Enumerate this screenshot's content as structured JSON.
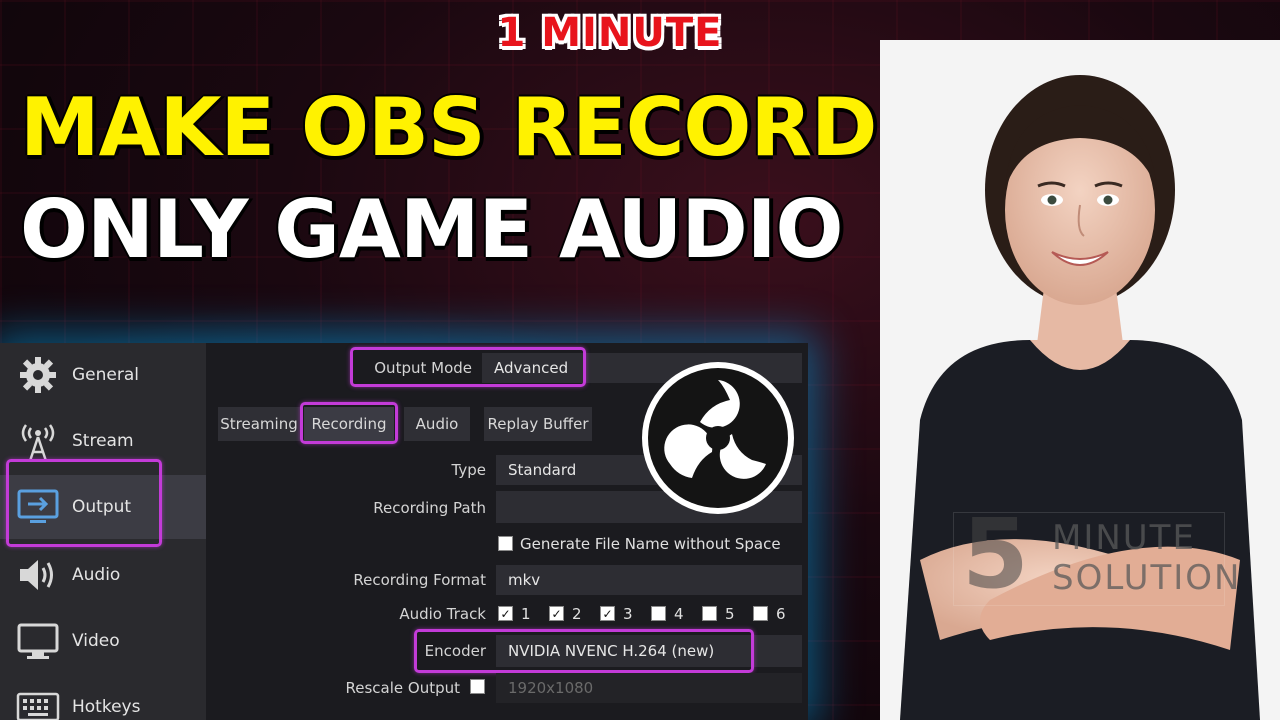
{
  "thumbnail": {
    "badge": "1 MINUTE",
    "headline_line1": "MAKE OBS RECORD",
    "headline_line2": "ONLY GAME AUDIO",
    "colors": {
      "badge_red": "#e8141c",
      "headline_yellow": "#fff200",
      "highlight_purple": "#c33bd8",
      "glow_blue": "#00aaff"
    }
  },
  "sidebar": {
    "items": [
      {
        "label": "General",
        "icon": "gear-icon"
      },
      {
        "label": "Stream",
        "icon": "broadcast-tower-icon"
      },
      {
        "label": "Output",
        "icon": "output-monitor-icon",
        "active": true
      },
      {
        "label": "Audio",
        "icon": "speaker-icon"
      },
      {
        "label": "Video",
        "icon": "monitor-icon"
      },
      {
        "label": "Hotkeys",
        "icon": "keyboard-icon"
      }
    ]
  },
  "output": {
    "mode_label": "Output Mode",
    "mode_value": "Advanced",
    "tabs": [
      "Streaming",
      "Recording",
      "Audio",
      "Replay Buffer"
    ],
    "active_tab": "Recording",
    "type_label": "Type",
    "type_value": "Standard",
    "path_label": "Recording Path",
    "path_value": "",
    "generate_name_label": "Generate File Name without Space",
    "format_label": "Recording Format",
    "format_value": "mkv",
    "audio_track_label": "Audio Track",
    "audio_tracks": [
      {
        "label": "1",
        "checked": true
      },
      {
        "label": "2",
        "checked": true
      },
      {
        "label": "3",
        "checked": true
      },
      {
        "label": "4",
        "checked": false
      },
      {
        "label": "5",
        "checked": false
      },
      {
        "label": "6",
        "checked": false
      }
    ],
    "encoder_label": "Encoder",
    "encoder_value": "NVIDIA NVENC H.264 (new)",
    "rescale_label": "Rescale Output",
    "rescale_value": "1920x1080"
  },
  "watermark": {
    "number": "5",
    "line1": "MINUTE",
    "line2": "SOLUTION"
  }
}
